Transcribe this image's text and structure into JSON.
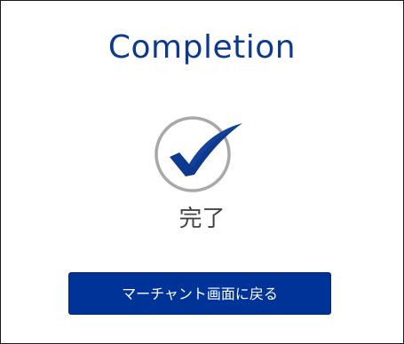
{
  "page": {
    "title": "Completion",
    "status_icon": "check-circle-icon",
    "status_text": "完了"
  },
  "actions": {
    "back_to_merchant_label": "マーチャント画面に戻る"
  },
  "colors": {
    "title": "#0d3a8e",
    "check": "#0d3a8e",
    "circle": "#a8a8a8",
    "button_bg": "#003398",
    "button_text": "#ffffff",
    "status_text": "#444444"
  }
}
